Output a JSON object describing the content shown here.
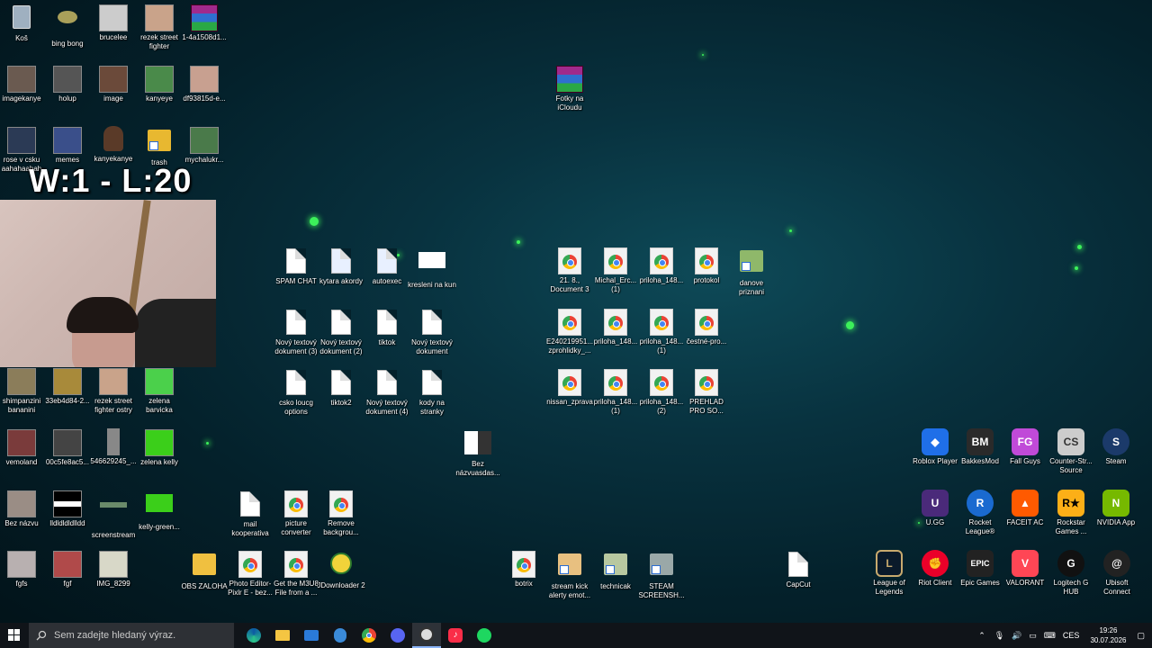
{
  "overlay": {
    "score_text": "W:1 - L:20"
  },
  "desktop_icons": {
    "c1": [
      {
        "label": "Koš"
      },
      {
        "label": "imagekanye"
      },
      {
        "label": "rose v csku aahahaahah"
      },
      {
        "label": "shimpanzini bananini"
      },
      {
        "label": "vemoland"
      },
      {
        "label": "Bez názvu"
      },
      {
        "label": "fgfs"
      }
    ],
    "c2": [
      {
        "label": "bing bong"
      },
      {
        "label": "holup"
      },
      {
        "label": "memes"
      },
      {
        "label": "33eb4d84-2..."
      },
      {
        "label": "00c5fe8ac5..."
      },
      {
        "label": "lldldldldlldd"
      },
      {
        "label": "fgf"
      }
    ],
    "c3": [
      {
        "label": "brucelee"
      },
      {
        "label": "image"
      },
      {
        "label": "kanyekanye"
      },
      {
        "label": "rezek street fighter ostry"
      },
      {
        "label": "546629245_..."
      },
      {
        "label": "screenstream"
      },
      {
        "label": "IMG_8299"
      }
    ],
    "c4": [
      {
        "label": "rezek street fighter"
      },
      {
        "label": "kanyeye"
      },
      {
        "label": "trash"
      },
      {
        "label": "zelena barvicka"
      },
      {
        "label": "zelena kelly"
      },
      {
        "label": "kelly-green..."
      }
    ],
    "c5": [
      {
        "label": "1-4a1508d1..."
      },
      {
        "label": "df93815d-e..."
      },
      {
        "label": "mychalukr..."
      }
    ],
    "middle": [
      {
        "label": "SPAM CHAT"
      },
      {
        "label": "kytara akordy"
      },
      {
        "label": "autoexec"
      },
      {
        "label": "kresleni na kun"
      },
      {
        "label": "Nový textový dokument (3)"
      },
      {
        "label": "Nový textový dokument (2)"
      },
      {
        "label": "tiktok"
      },
      {
        "label": "Nový textový dokument"
      },
      {
        "label": "csko loucg options"
      },
      {
        "label": "tiktok2"
      },
      {
        "label": "Nový textový dokument (4)"
      },
      {
        "label": "kody na stranky"
      }
    ],
    "chrome_grid": [
      {
        "label": "21. 8., Document 3"
      },
      {
        "label": "Michal_Erc... (1)"
      },
      {
        "label": "priloha_148..."
      },
      {
        "label": "protokol"
      },
      {
        "label": "danove priznani"
      },
      {
        "label": "E240219951... zprohlidky_..."
      },
      {
        "label": "priloha_148..."
      },
      {
        "label": "priloha_148... (1)"
      },
      {
        "label": "čestné-pro..."
      },
      {
        "label": "nissan_zprava"
      },
      {
        "label": "priloha_148... (1)"
      },
      {
        "label": "priloha_148... (2)"
      },
      {
        "label": "PREHLAD PRO SO..."
      }
    ],
    "fotky": {
      "label": "Fotky na iCloudu"
    },
    "bez_nazvu": {
      "label": "Bez názvuasdas..."
    },
    "row_6": [
      {
        "label": "mail kooperativa"
      },
      {
        "label": "picture converter"
      },
      {
        "label": "Remove backgrou..."
      }
    ],
    "row_7": [
      {
        "label": "OBS ZALOHA"
      },
      {
        "label": "Photo Editor- Pixlr E - bez..."
      },
      {
        "label": "Get the M3U8 File from a ..."
      },
      {
        "label": "JDownloader 2"
      },
      {
        "label": "botrix"
      },
      {
        "label": "stream kick alerty emot..."
      },
      {
        "label": "technicak"
      },
      {
        "label": "STEAM SCREENSH..."
      },
      {
        "label": "CapCut"
      }
    ],
    "games_r1": [
      {
        "label": "Roblox Player"
      },
      {
        "label": "BakkesMod"
      },
      {
        "label": "Fall Guys"
      },
      {
        "label": "Counter-Str... Source"
      },
      {
        "label": "Steam"
      }
    ],
    "games_r2": [
      {
        "label": "U.GG"
      },
      {
        "label": "Rocket League®"
      },
      {
        "label": "FACEIT AC"
      },
      {
        "label": "Rockstar Games ..."
      },
      {
        "label": "NVIDIA App"
      }
    ],
    "games_r3": [
      {
        "label": "League of Legends"
      },
      {
        "label": "Riot Client"
      },
      {
        "label": "Epic Games"
      },
      {
        "label": "VALORANT"
      },
      {
        "label": "Logitech G HUB"
      },
      {
        "label": "Ubisoft Connect"
      }
    ]
  },
  "taskbar": {
    "search_placeholder": "Sem zadejte hledaný výraz.",
    "language": "CES",
    "time": "19:26",
    "date": "30.07.2026"
  }
}
